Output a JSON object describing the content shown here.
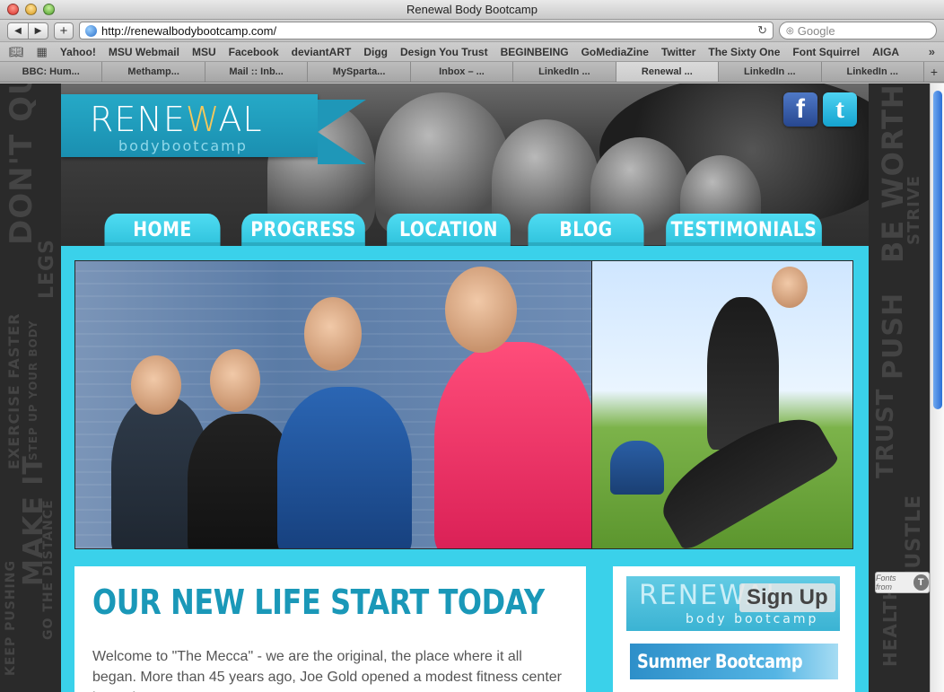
{
  "window": {
    "title": "Renewal Body Bootcamp"
  },
  "toolbar": {
    "back_icon": "◀",
    "forward_icon": "▶",
    "add_icon": "+",
    "url": "http://renewalbodybootcamp.com/",
    "reload_icon": "↻",
    "search_placeholder": "Google",
    "search_icon": "🔍"
  },
  "bookmarks": {
    "items": [
      "Yahoo!",
      "MSU Webmail",
      "MSU",
      "Facebook",
      "deviantART",
      "Digg",
      "Design You Trust",
      "BEGINBEING",
      "GoMediaZine",
      "Twitter",
      "The Sixty One",
      "Font Squirrel",
      "AIGA"
    ],
    "more_icon": "»"
  },
  "tabs": {
    "items": [
      "BBC: Hum...",
      "Methamp...",
      "Mail :: Inb...",
      "MySparta...",
      "Inbox – ...",
      "LinkedIn ...",
      "Renewal ...",
      "LinkedIn ...",
      "LinkedIn ..."
    ],
    "active_index": 6,
    "add_icon": "+"
  },
  "site": {
    "logo": {
      "main_pre": "RENE",
      "main_accent": "W",
      "main_post": "AL",
      "sub": "bodybootcamp"
    },
    "social": {
      "facebook": "f",
      "twitter": "t"
    },
    "nav": [
      "HOME",
      "PROGRESS",
      "LOCATION",
      "BLOG",
      "TESTIMONIALS"
    ],
    "content": {
      "title": "OUR NEW LIFE START TODAY",
      "body": "Welcome to \"The Mecca\" - we are the original, the place where it all began. More than 45 years ago, Joe Gold opened a modest fitness center in Venice"
    },
    "sidebar": {
      "signup_logo": "RENEWAL",
      "signup_sub": "body bootcamp",
      "signup_label": "Sign Up",
      "summer_label": "Summer Bootcamp"
    },
    "fonts_badge": {
      "label": "Fonts from",
      "icon": "T"
    }
  },
  "side_words": {
    "left": [
      "DON'T QUIT",
      "LEGS",
      "EXERCISE FASTER",
      "MAKE IT",
      "KEEP PUSHING",
      "GO THE DISTANCE",
      "STEP UP YOUR BODY"
    ],
    "right": [
      "BE WORTH",
      "STRIVE",
      "PUSH",
      "TRUST",
      "HUSTLE",
      "HEALTHY"
    ]
  },
  "colors": {
    "accent": "#3ad1ea",
    "title": "#1a98b8",
    "logo_accent": "#f6c85b"
  }
}
